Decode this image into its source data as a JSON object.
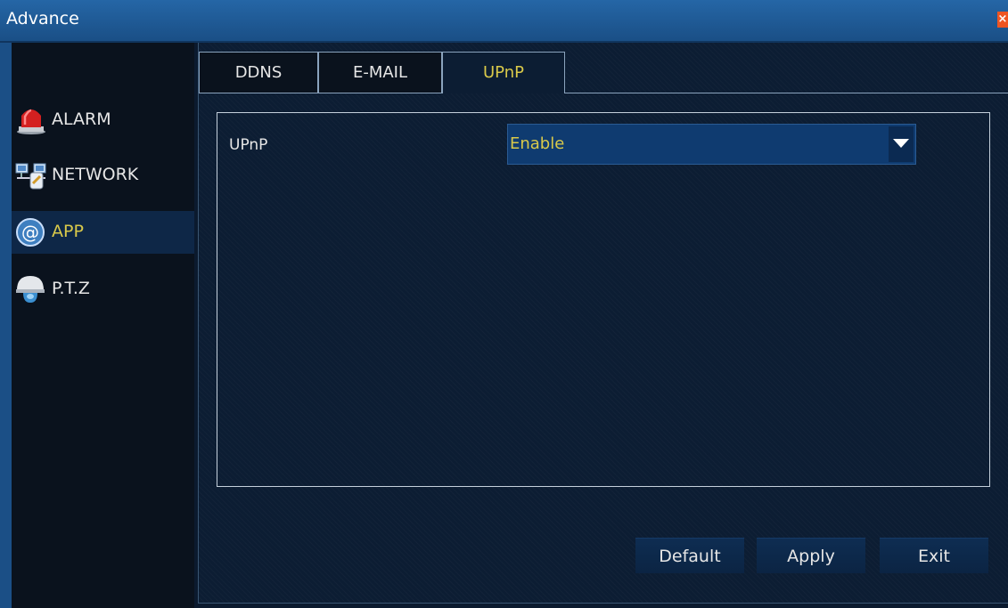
{
  "window": {
    "title": "Advance",
    "close_glyph": "×"
  },
  "sidebar": {
    "items": [
      {
        "label": "ALARM",
        "icon": "alarm-light-icon",
        "active": false
      },
      {
        "label": "NETWORK",
        "icon": "network-icon",
        "active": false
      },
      {
        "label": "APP",
        "icon": "at-sign-icon",
        "active": true
      },
      {
        "label": "P.T.Z",
        "icon": "dome-camera-icon",
        "active": false
      }
    ]
  },
  "tabs": [
    {
      "label": "DDNS",
      "active": false
    },
    {
      "label": "E-MAIL",
      "active": false
    },
    {
      "label": "UPnP",
      "active": true
    }
  ],
  "form": {
    "upnp_label": "UPnP",
    "upnp_value": "Enable"
  },
  "buttons": {
    "default_label": "Default",
    "apply_label": "Apply",
    "exit_label": "Exit"
  },
  "colors": {
    "titlebar": "#1a4f86",
    "accent_text": "#d9c94a",
    "select_bg": "#0f3b70",
    "close_button": "#ee5522"
  }
}
